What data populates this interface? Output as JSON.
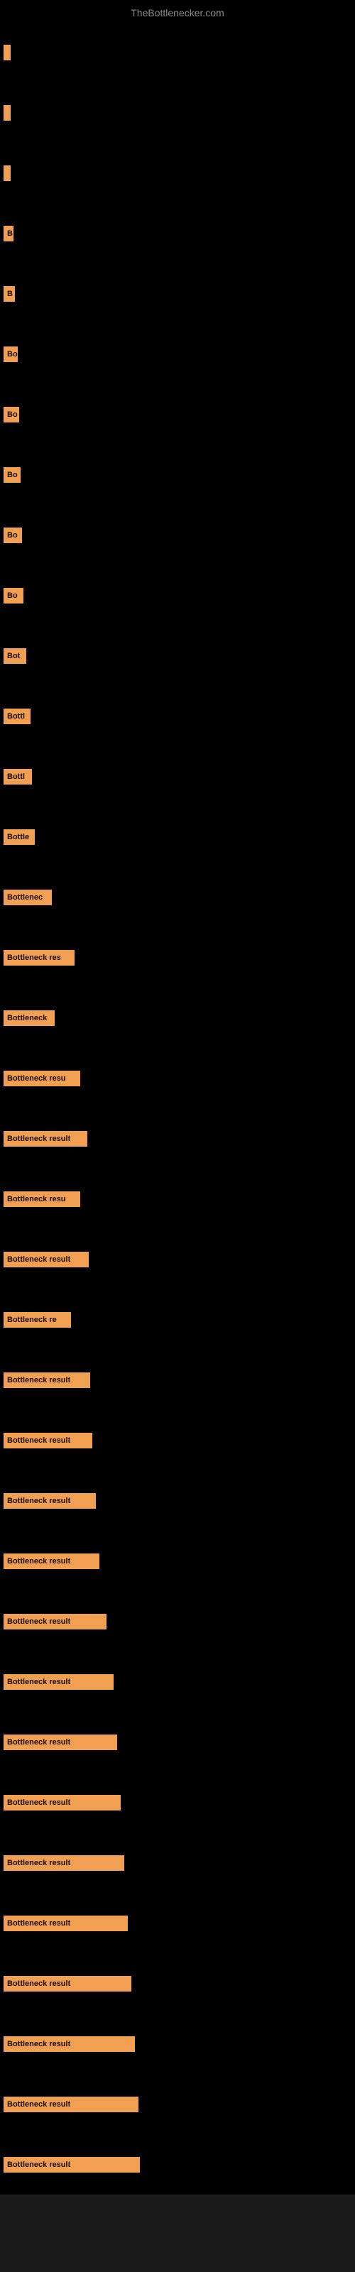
{
  "title": "TheBottlenecker.com",
  "rows": [
    {
      "label": "",
      "width": 6
    },
    {
      "label": "",
      "width": 8
    },
    {
      "label": "",
      "width": 10
    },
    {
      "label": "B",
      "width": 14
    },
    {
      "label": "B",
      "width": 16
    },
    {
      "label": "Bo",
      "width": 20
    },
    {
      "label": "Bo",
      "width": 22
    },
    {
      "label": "Bo",
      "width": 24
    },
    {
      "label": "Bo",
      "width": 26
    },
    {
      "label": "Bo",
      "width": 28
    },
    {
      "label": "Bot",
      "width": 32
    },
    {
      "label": "Bottl",
      "width": 38
    },
    {
      "label": "Bottl",
      "width": 40
    },
    {
      "label": "Bottle",
      "width": 44
    },
    {
      "label": "Bottlenec",
      "width": 68
    },
    {
      "label": "Bottleneck res",
      "width": 100
    },
    {
      "label": "Bottleneck",
      "width": 72
    },
    {
      "label": "Bottleneck resu",
      "width": 108
    },
    {
      "label": "Bottleneck result",
      "width": 118
    },
    {
      "label": "Bottleneck resu",
      "width": 108
    },
    {
      "label": "Bottleneck result",
      "width": 120
    },
    {
      "label": "Bottleneck re",
      "width": 95
    },
    {
      "label": "Bottleneck result",
      "width": 122
    },
    {
      "label": "Bottleneck result",
      "width": 125
    },
    {
      "label": "Bottleneck result",
      "width": 130
    },
    {
      "label": "Bottleneck result",
      "width": 135
    },
    {
      "label": "Bottleneck result",
      "width": 145
    },
    {
      "label": "Bottleneck result",
      "width": 155
    },
    {
      "label": "Bottleneck result",
      "width": 160
    },
    {
      "label": "Bottleneck result",
      "width": 165
    },
    {
      "label": "Bottleneck result",
      "width": 170
    },
    {
      "label": "Bottleneck result",
      "width": 175
    },
    {
      "label": "Bottleneck result",
      "width": 180
    },
    {
      "label": "Bottleneck result",
      "width": 185
    },
    {
      "label": "Bottleneck result",
      "width": 190
    },
    {
      "label": "Bottleneck result",
      "width": 192
    }
  ]
}
